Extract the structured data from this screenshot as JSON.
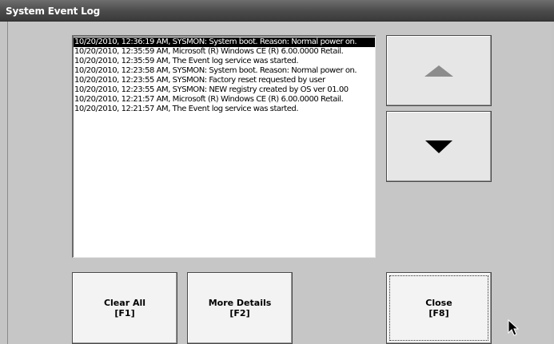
{
  "window": {
    "title": "System Event Log"
  },
  "log": {
    "selected_index": 0,
    "entries": [
      "10/20/2010, 12:36:19 AM, SYSMON: System boot. Reason: Normal power on.",
      "10/20/2010, 12:35:59 AM, Microsoft (R) Windows CE (R) 6.00.0000 Retail.",
      "10/20/2010, 12:35:59 AM, The Event log service was started.",
      "10/20/2010, 12:23:58 AM, SYSMON: System boot. Reason: Normal power on.",
      "10/20/2010, 12:23:55 AM, SYSMON: Factory reset requested by user",
      "10/20/2010, 12:23:55 AM, SYSMON: NEW registry created by OS ver 01.00",
      "10/20/2010, 12:21:57 AM, Microsoft (R) Windows CE (R) 6.00.0000 Retail.",
      "10/20/2010, 12:21:57 AM, The Event log service was started."
    ]
  },
  "buttons": {
    "clear_all": {
      "label": "Clear All",
      "key": "[F1]"
    },
    "more_details": {
      "label": "More Details",
      "key": "[F2]"
    },
    "close": {
      "label": "Close",
      "key": "[F8]"
    }
  },
  "icons": {
    "scroll_up": "up-arrow-icon",
    "scroll_down": "down-arrow-icon",
    "cursor": "mouse-pointer-icon"
  },
  "colors": {
    "titlebar": "#4a4a4a",
    "background": "#c6c6c6",
    "selection": "#000000",
    "up_arrow": "#8c8c8c",
    "down_arrow": "#000000"
  }
}
